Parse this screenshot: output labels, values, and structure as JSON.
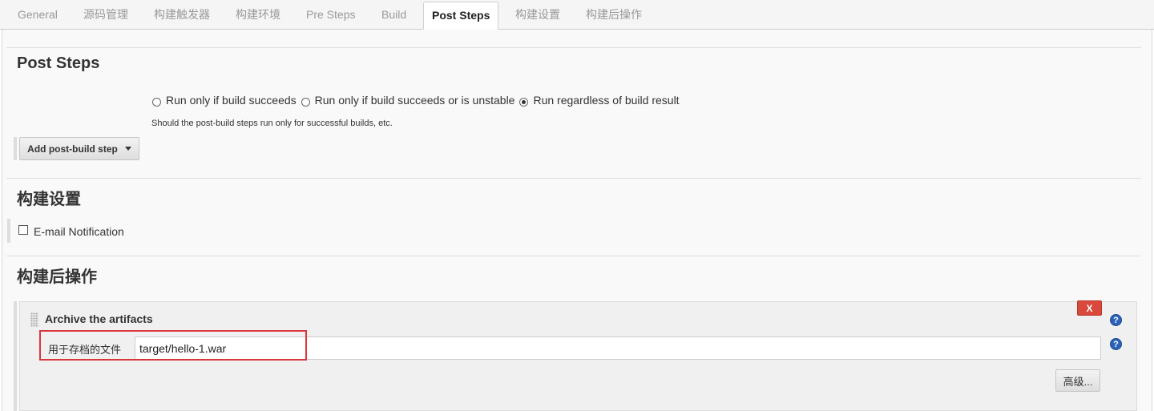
{
  "tabs": [
    {
      "label": "General"
    },
    {
      "label": "源码管理"
    },
    {
      "label": "构建触发器"
    },
    {
      "label": "构建环境"
    },
    {
      "label": "Pre Steps"
    },
    {
      "label": "Build"
    },
    {
      "label": "Post Steps",
      "active": true
    },
    {
      "label": "构建设置"
    },
    {
      "label": "构建后操作"
    }
  ],
  "post_steps": {
    "title": "Post Steps",
    "options": [
      {
        "label": "Run only if build succeeds",
        "checked": false
      },
      {
        "label": "Run only if build succeeds or is unstable",
        "checked": false
      },
      {
        "label": "Run regardless of build result",
        "checked": true
      }
    ],
    "help": "Should the post-build steps run only for successful builds, etc.",
    "add_button": "Add post-build step"
  },
  "build_settings": {
    "title": "构建设置",
    "email_label": "E-mail Notification",
    "email_checked": false
  },
  "post_build": {
    "title": "构建后操作",
    "archive": {
      "title": "Archive the artifacts",
      "delete_label": "X",
      "field_label": "用于存档的文件",
      "field_value": "target/hello-1.war",
      "advanced_label": "高级..."
    },
    "help_glyph": "?"
  },
  "colors": {
    "delete_button": "#d9493c",
    "help_icon": "#2a63b8",
    "highlight_box": "#d9363e"
  }
}
